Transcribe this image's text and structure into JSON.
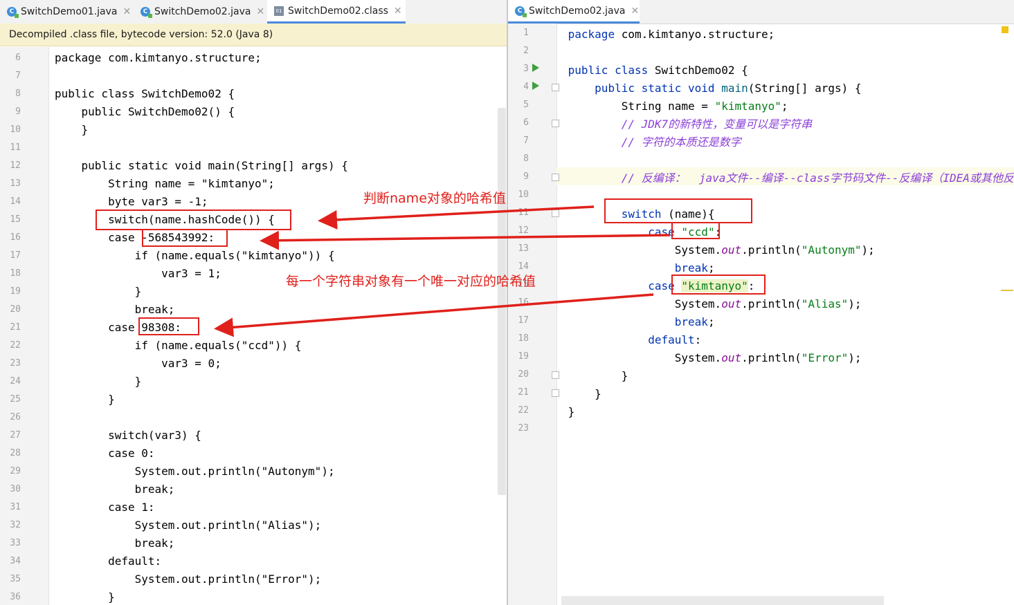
{
  "left_tabs": [
    {
      "label": "SwitchDemo01.java",
      "icon": "java-class-icon"
    },
    {
      "label": "SwitchDemo02.java",
      "icon": "java-class-icon"
    },
    {
      "label": "SwitchDemo02.class",
      "icon": "class-file-icon"
    }
  ],
  "right_tabs": [
    {
      "label": "SwitchDemo02.java",
      "icon": "java-class-icon"
    }
  ],
  "banner": "Decompiled .class file, bytecode version: 52.0 (Java 8)",
  "left_code": {
    "line_numbers": [
      "6",
      "7",
      "8",
      "9",
      "10",
      "11",
      "12",
      "13",
      "14",
      "15",
      "16",
      "17",
      "18",
      "19",
      "20",
      "21",
      "22",
      "23",
      "24",
      "25",
      "26",
      "27",
      "28",
      "29",
      "30",
      "31",
      "32",
      "33",
      "34",
      "35",
      "36"
    ],
    "lines": [
      "package com.kimtanyo.structure;",
      "",
      "public class SwitchDemo02 {",
      "    public SwitchDemo02() {",
      "    }",
      "",
      "    public static void main(String[] args) {",
      "        String name = \"kimtanyo\";",
      "        byte var3 = -1;",
      "        switch(name.hashCode()) {",
      "        case -568543992:",
      "            if (name.equals(\"kimtanyo\")) {",
      "                var3 = 1;",
      "            }",
      "            break;",
      "        case 98308:",
      "            if (name.equals(\"ccd\")) {",
      "                var3 = 0;",
      "            }",
      "        }",
      "",
      "        switch(var3) {",
      "        case 0:",
      "            System.out.println(\"Autonym\");",
      "            break;",
      "        case 1:",
      "            System.out.println(\"Alias\");",
      "            break;",
      "        default:",
      "            System.out.println(\"Error\");",
      "        }"
    ]
  },
  "right_code": {
    "line_numbers": [
      "1",
      "2",
      "3",
      "4",
      "5",
      "6",
      "7",
      "8",
      "9",
      "10",
      "11",
      "12",
      "13",
      "14",
      "15",
      "16",
      "17",
      "18",
      "19",
      "20",
      "21",
      "22",
      "23"
    ]
  },
  "annotations": {
    "hash_note": "判断name对象的哈希值",
    "unique_note": "每一个字符串对象有一个唯一对应的哈希值"
  },
  "colors": {
    "annotation": "#e0201b",
    "keyword": "#0033b3",
    "string": "#067d17",
    "comment": "#8b3fd9"
  }
}
